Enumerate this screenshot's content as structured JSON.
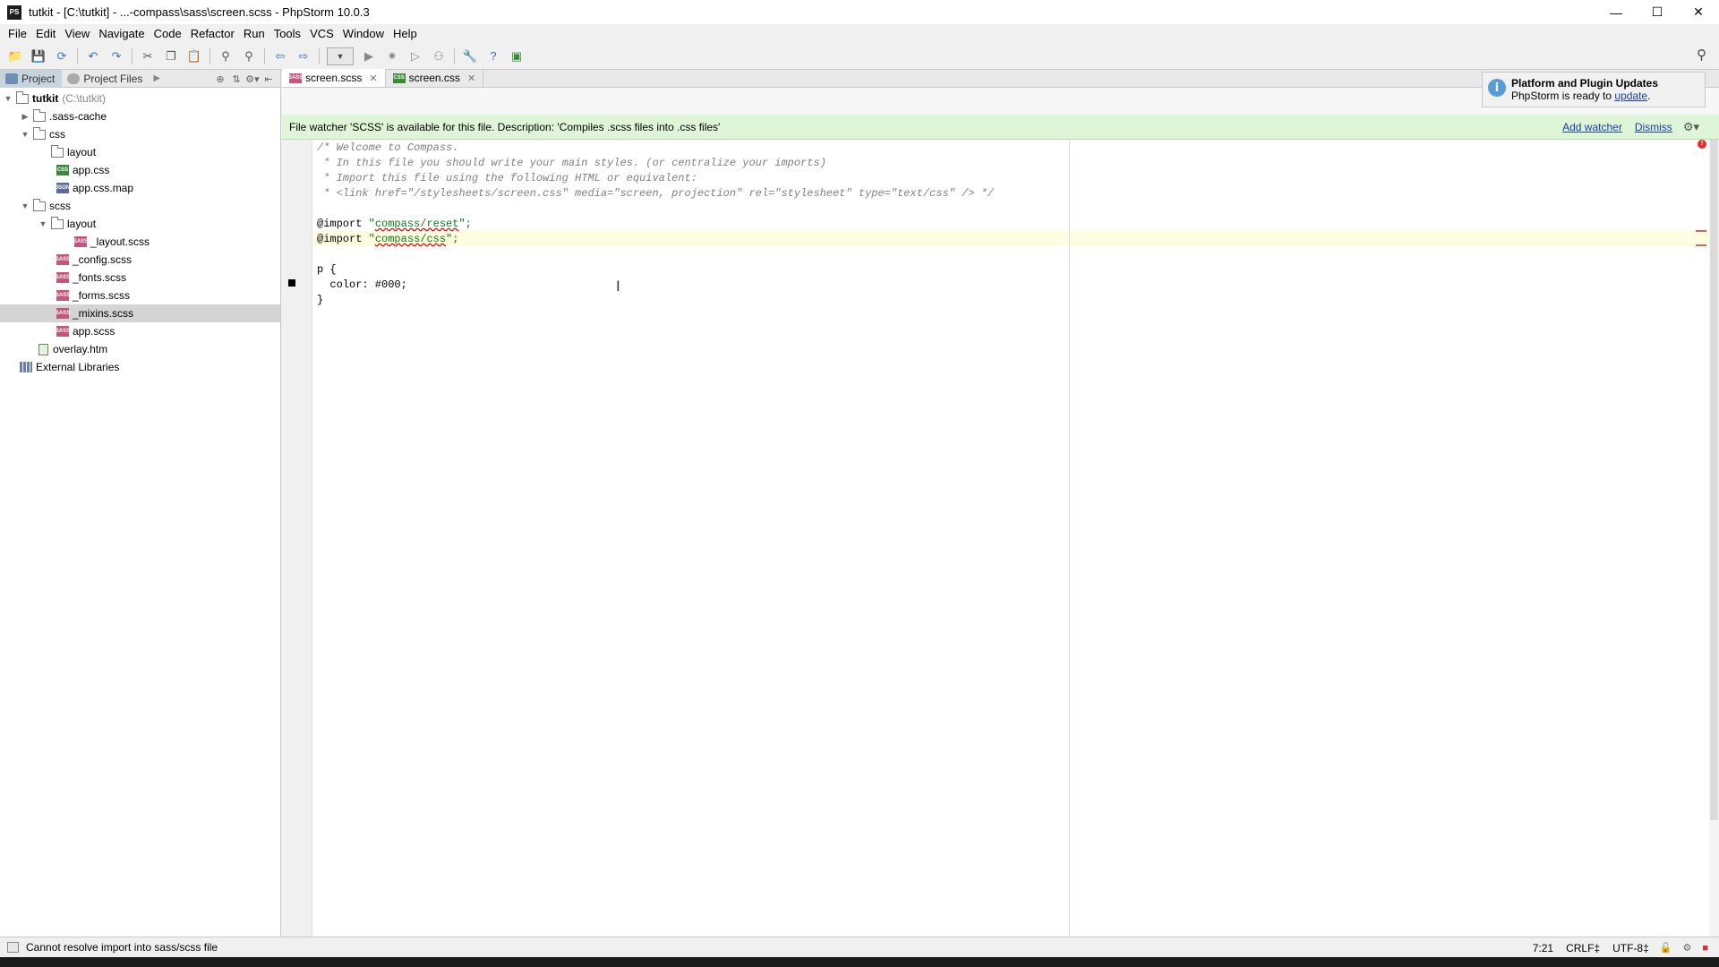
{
  "window": {
    "title": "tutkit - [C:\\tutkit] - ...-compass\\sass\\screen.scss - PhpStorm 10.0.3",
    "app_icon_label": "PS"
  },
  "menu": [
    "File",
    "Edit",
    "View",
    "Navigate",
    "Code",
    "Refactor",
    "Run",
    "Tools",
    "VCS",
    "Window",
    "Help"
  ],
  "project_panel": {
    "tabs": [
      {
        "label": "Project",
        "active": true
      },
      {
        "label": "Project Files",
        "active": false
      }
    ]
  },
  "tree": [
    {
      "label": "tutkit",
      "path": "(C:\\tutkit)",
      "type": "root",
      "depth": 0,
      "expanded": true
    },
    {
      "label": ".sass-cache",
      "type": "folder",
      "depth": 1,
      "expanded": false
    },
    {
      "label": "css",
      "type": "folder",
      "depth": 1,
      "expanded": true
    },
    {
      "label": "layout",
      "type": "folder",
      "depth": 2
    },
    {
      "label": "app.css",
      "type": "css",
      "depth": 2
    },
    {
      "label": "app.css.map",
      "type": "map",
      "depth": 2
    },
    {
      "label": "scss",
      "type": "folder",
      "depth": 1,
      "expanded": true
    },
    {
      "label": "layout",
      "type": "folder",
      "depth": 2,
      "expanded": true
    },
    {
      "label": "_layout.scss",
      "type": "scss",
      "depth": 3
    },
    {
      "label": "_config.scss",
      "type": "scss",
      "depth": 2
    },
    {
      "label": "_fonts.scss",
      "type": "scss",
      "depth": 2
    },
    {
      "label": "_forms.scss",
      "type": "scss",
      "depth": 2
    },
    {
      "label": "_mixins.scss",
      "type": "scss",
      "depth": 2,
      "selected": true
    },
    {
      "label": "app.scss",
      "type": "scss",
      "depth": 2
    },
    {
      "label": "overlay.htm",
      "type": "htm",
      "depth": 1
    },
    {
      "label": "External Libraries",
      "type": "lib",
      "depth": 0
    }
  ],
  "editor": {
    "tabs": [
      {
        "label": "screen.scss",
        "icon": "SASS",
        "active": true
      },
      {
        "label": "screen.css",
        "icon": "CSS",
        "active": false
      }
    ],
    "banner": {
      "text": "File watcher 'SCSS' is available for this file. Description: 'Compiles .scss files into .css files'",
      "add_watcher": "Add watcher",
      "dismiss": "Dismiss"
    },
    "code": {
      "line1": "/* Welcome to Compass.",
      "line2": " * In this file you should write your main styles. (or centralize your imports)",
      "line3": " * Import this file using the following HTML or equivalent:",
      "line4": " * <link href=\"/stylesheets/screen.css\" media=\"screen, projection\" rel=\"stylesheet\" type=\"text/css\" /> */",
      "import_kw": "@import",
      "import1_open": "\"",
      "import1_path": "compass/reset",
      "import1_close": "\";",
      "import2_open": "\"",
      "import2_path": "compass/css",
      "import2_close": "\";",
      "rule_open": "p {",
      "declaration": "  color: #000;",
      "rule_close": "}"
    }
  },
  "notification": {
    "title": "Platform and Plugin Updates",
    "body": "PhpStorm is ready to",
    "link": "update",
    "suffix": "."
  },
  "status": {
    "message": "Cannot resolve import into sass/scss file",
    "position": "7:21",
    "line_sep": "CRLF‡",
    "encoding": "UTF-8‡"
  },
  "colors": {
    "banner_bg": "#dff5d8",
    "string_green": "#067d17",
    "comment_grey": "#808080",
    "link_blue": "#1a3ba8",
    "error_red": "#e03030"
  }
}
